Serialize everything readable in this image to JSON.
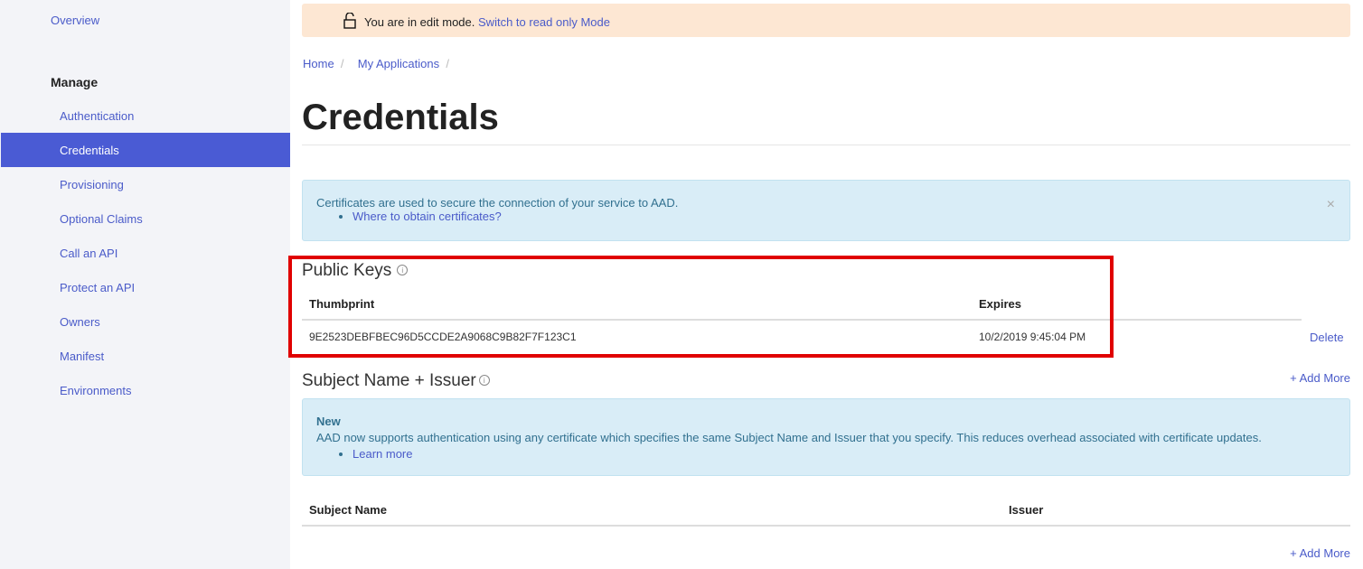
{
  "sidebar": {
    "overview": "Overview",
    "manage": "Manage",
    "items": [
      "Authentication",
      "Credentials",
      "Provisioning",
      "Optional Claims",
      "Call an API",
      "Protect an API",
      "Owners",
      "Manifest",
      "Environments"
    ],
    "active": "Credentials"
  },
  "banner": {
    "text": "You are in edit mode.",
    "link": "Switch to read only Mode"
  },
  "breadcrumb": [
    "Home",
    "My Applications"
  ],
  "title": "Credentials",
  "cert_info": {
    "text": "Certificates are used to secure the connection of your service to AAD.",
    "link": "Where to obtain certificates?",
    "close": "×"
  },
  "public_keys": {
    "title": "Public Keys",
    "columns": [
      "Thumbprint",
      "Expires"
    ],
    "rows": [
      {
        "thumbprint": "9E2523DEBFBEC96D5CCDE2A9068C9B82F7F123C1",
        "expires": "10/2/2019 9:45:04 PM",
        "action": "Delete"
      }
    ]
  },
  "subject": {
    "title": "Subject Name + Issuer",
    "add_more": "+ Add More",
    "info_title": "New",
    "info_text": "AAD now supports authentication using any certificate which specifies the same Subject Name and Issuer that you specify. This reduces overhead associated with certificate updates.",
    "info_link": "Learn more",
    "columns": [
      "Subject Name",
      "Issuer"
    ],
    "add_more_bottom": "+ Add More"
  }
}
